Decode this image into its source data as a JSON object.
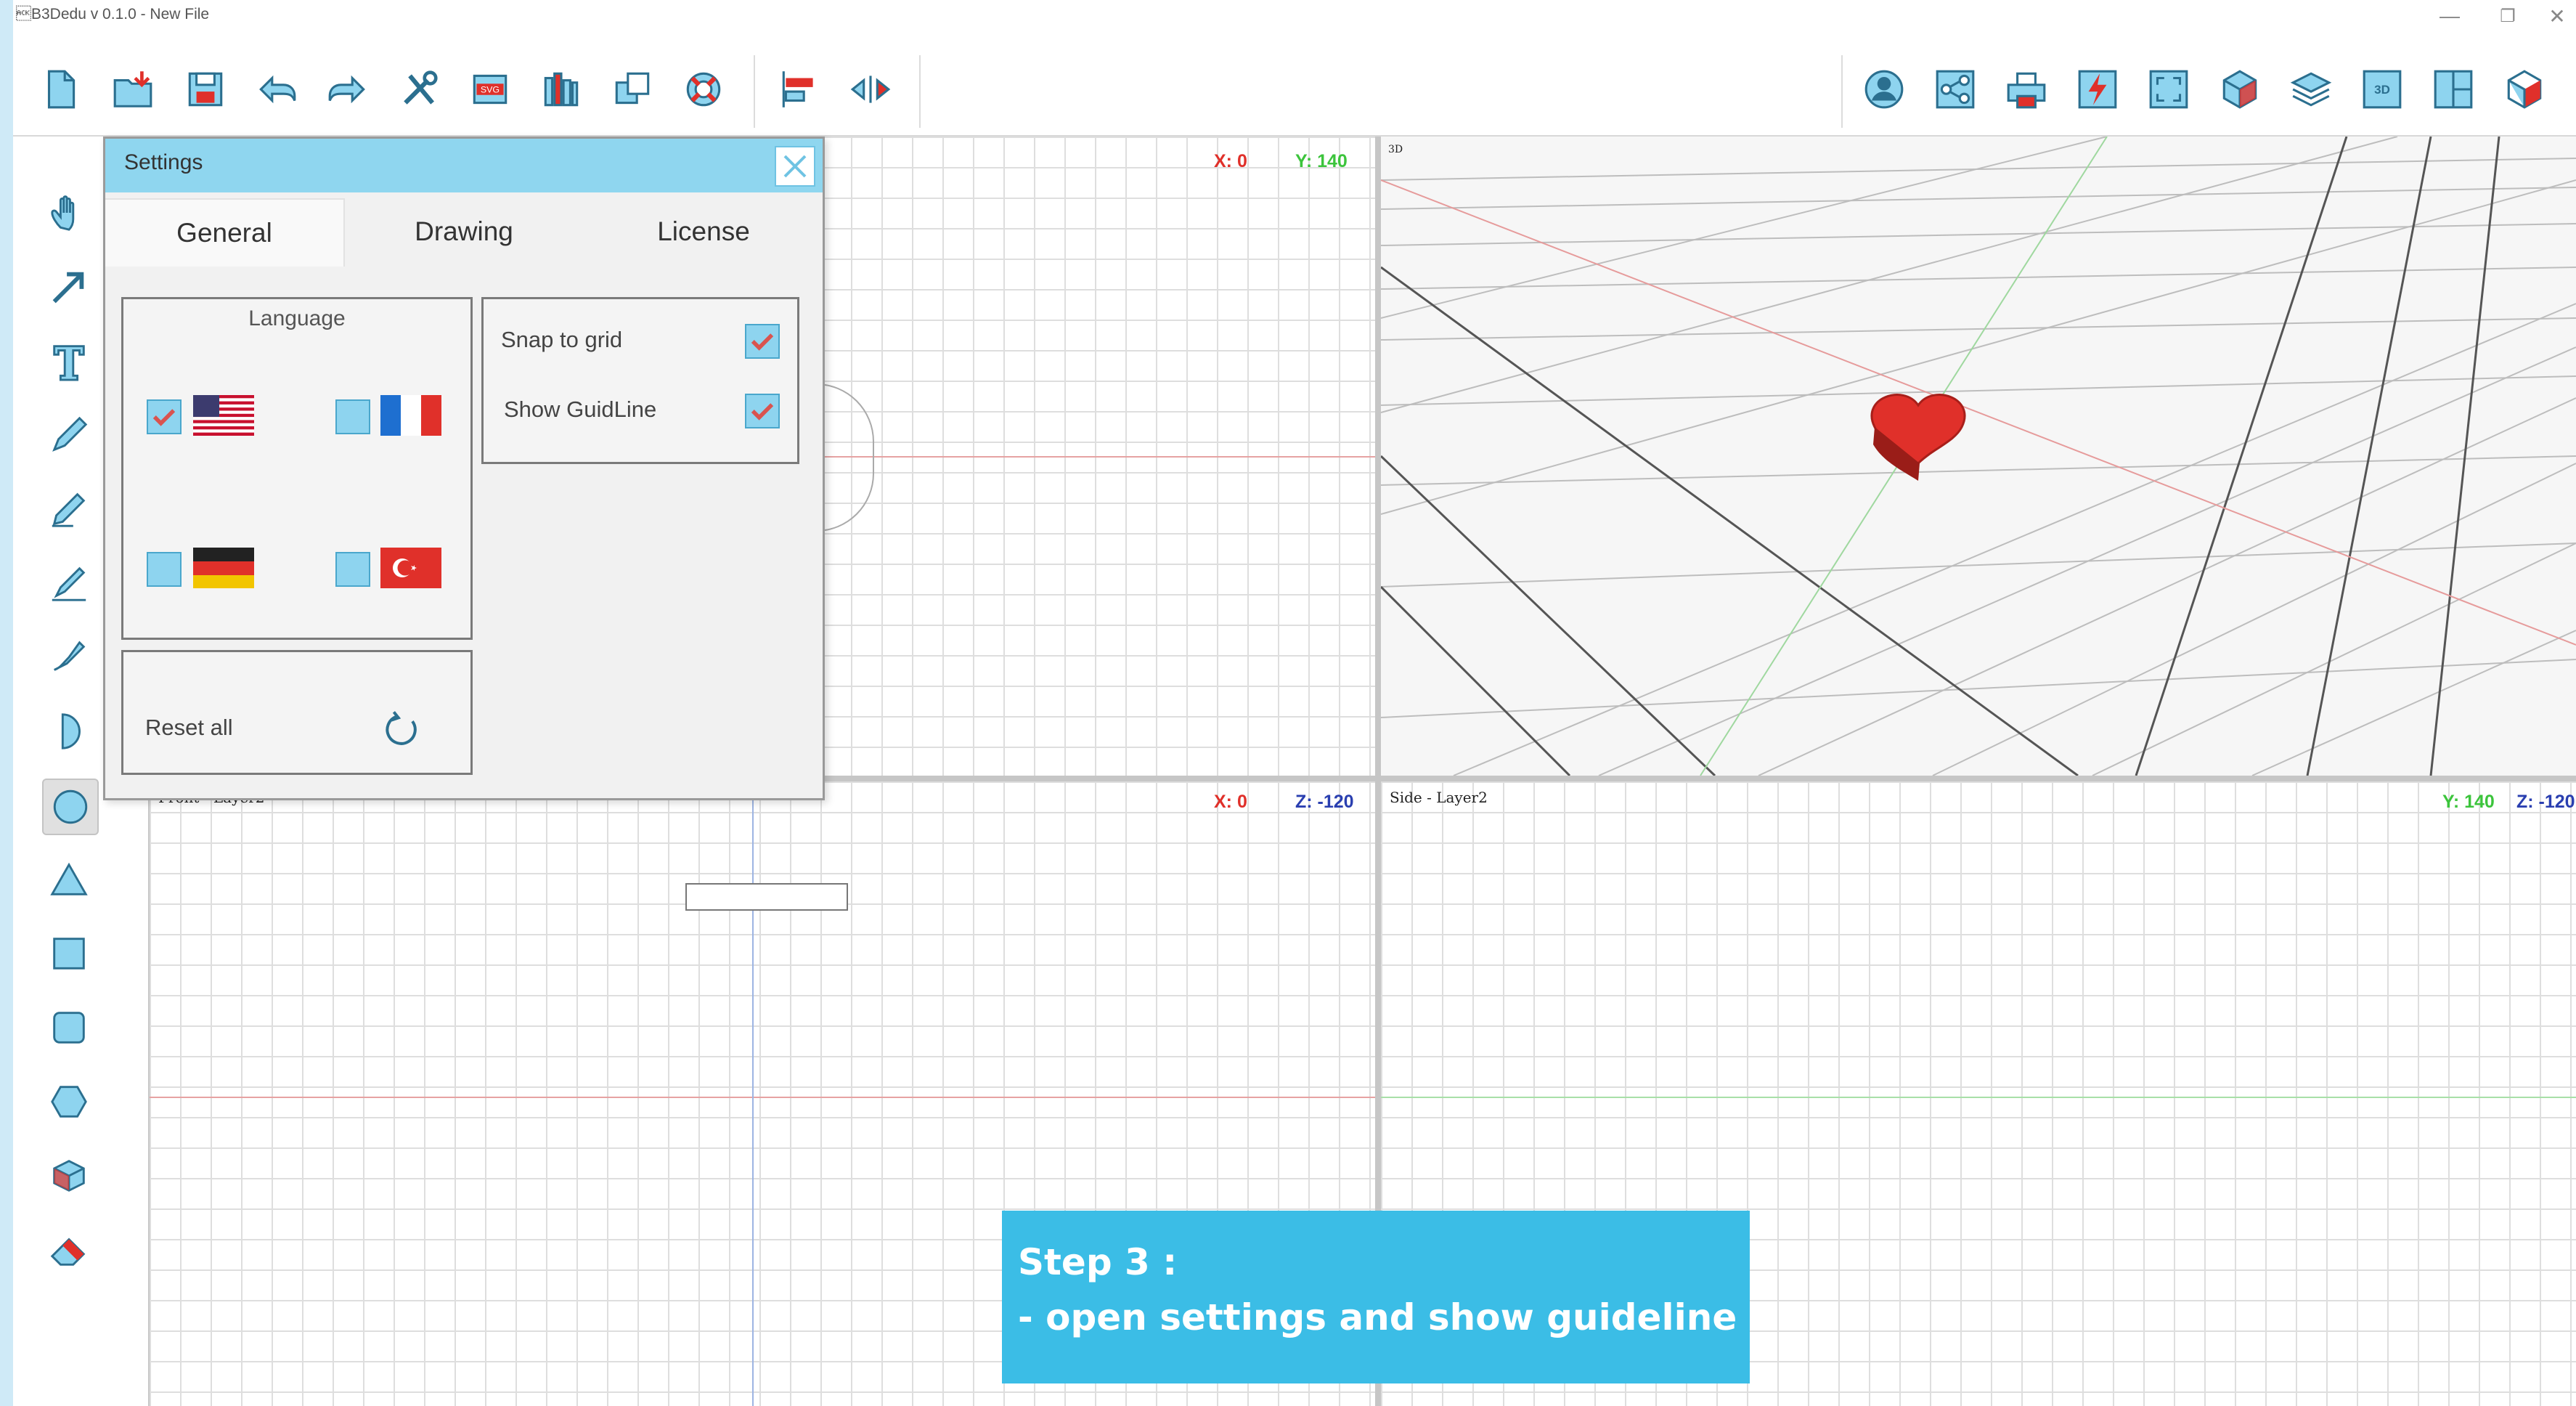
{
  "window": {
    "title": "\u0006B3Dedu v 0.1.0 - New File",
    "minimize": "—",
    "restore": "❐",
    "close": "✕"
  },
  "toolbar": {
    "left_icons": [
      "new-file-icon",
      "open-folder-icon",
      "save-icon",
      "undo-icon",
      "redo-icon",
      "tools-icon",
      "svg-export-icon",
      "library-icon",
      "copy-icon",
      "help-lifebuoy-icon",
      "align-icon",
      "mirror-icon"
    ],
    "right_icons": [
      "user-icon",
      "share-icon",
      "print-icon",
      "flash-icon",
      "fullscreen-icon",
      "cube-icon",
      "layers-icon",
      "view-3d-icon",
      "panels-icon",
      "export-3d-icon"
    ]
  },
  "left_tools": [
    "hand-icon",
    "arrow-icon",
    "text-icon",
    "pen-icon",
    "pencil-icon",
    "brush-icon",
    "curve-icon",
    "half-circle-icon",
    "circle-icon",
    "triangle-icon",
    "square-icon",
    "rounded-square-icon",
    "hexagon-icon",
    "box-3d-icon",
    "eraser-icon"
  ],
  "viewports": {
    "top": {
      "coord_x": "X: 0",
      "coord_y": "Y: 140"
    },
    "three_d": {
      "label": "3D"
    },
    "front": {
      "label": "Front - Layer2",
      "coord_x": "X: 0",
      "coord_z": "Z: -120"
    },
    "side": {
      "label": "Side - Layer2",
      "coord_y": "Y: 140",
      "coord_z": "Z: -120"
    }
  },
  "settings": {
    "title": "Settings",
    "tabs": [
      "General",
      "Drawing",
      "License"
    ],
    "active_tab": "General",
    "language": {
      "title": "Language",
      "options": [
        {
          "lang": "English",
          "flag": "usa",
          "checked": true
        },
        {
          "lang": "French",
          "flag": "france",
          "checked": false
        },
        {
          "lang": "German",
          "flag": "germany",
          "checked": false
        },
        {
          "lang": "Turkish",
          "flag": "turkey",
          "checked": false
        }
      ]
    },
    "snap_to_grid": {
      "label": "Snap to grid",
      "checked": true
    },
    "show_guideline": {
      "label": "Show GuidLine",
      "checked": true
    },
    "reset": {
      "label": "Reset all"
    }
  },
  "callout": {
    "line1": "Step 3 :",
    "line2": "- open settings and show guideline"
  },
  "colors": {
    "accent": "#3bbde6",
    "header": "#8fd6ef",
    "check": "#d9534f",
    "heart": "#e0302a"
  }
}
